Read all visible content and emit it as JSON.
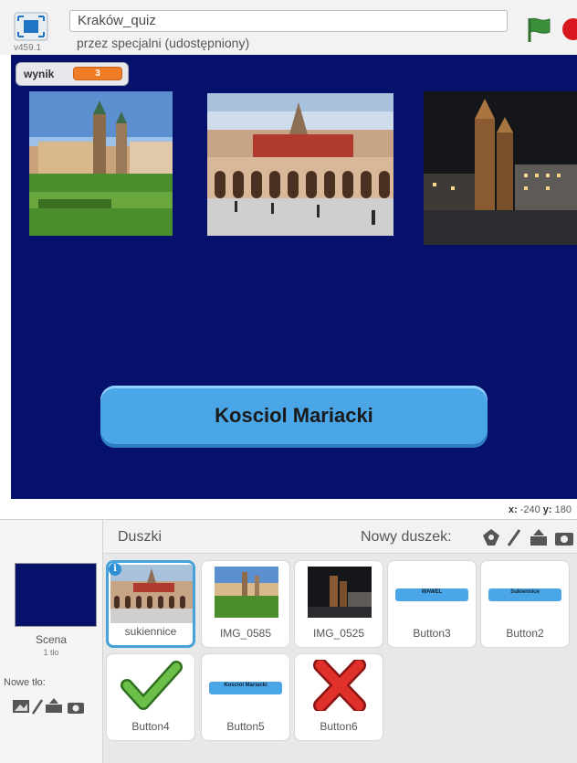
{
  "project": {
    "title": "Kraków_quiz",
    "byline": "przez specjalni (udostępniony)",
    "version": "v459.1"
  },
  "stage": {
    "background_color": "#06116b",
    "monitor": {
      "label": "wynik",
      "value": "3"
    },
    "answer_button": {
      "label": "Kosciol Mariacki"
    },
    "coords": {
      "x_label": "x:",
      "x_value": "-240",
      "y_label": "y:",
      "y_value": "180"
    }
  },
  "sprites_panel": {
    "heading": "Duszki",
    "new_sprite_label": "Nowy duszek:",
    "stage_label": "Scena",
    "stage_sub": "1 tło",
    "new_backdrop_label": "Nowe tło:",
    "sprites": [
      {
        "name": "sukiennice",
        "selected": true,
        "icon": "photo-cloth-hall"
      },
      {
        "name": "IMG_0585",
        "selected": false,
        "icon": "photo-wawel"
      },
      {
        "name": "IMG_0525",
        "selected": false,
        "icon": "photo-night-church"
      },
      {
        "name": "Button3",
        "selected": false,
        "icon": "blue-button",
        "mini_text": "WAWEL"
      },
      {
        "name": "Button2",
        "selected": false,
        "icon": "blue-button",
        "mini_text": "Sukiennice"
      },
      {
        "name": "Button4",
        "selected": false,
        "icon": "check-icon"
      },
      {
        "name": "Button5",
        "selected": false,
        "icon": "blue-button",
        "mini_text": "Kosciol Mariacki"
      },
      {
        "name": "Button6",
        "selected": false,
        "icon": "cross-icon"
      }
    ]
  },
  "colors": {
    "accent_blue": "#4aa6e6",
    "score_orange": "#f07d26",
    "green_flag": "#3a8f3a",
    "stop_red": "#d8181e"
  }
}
